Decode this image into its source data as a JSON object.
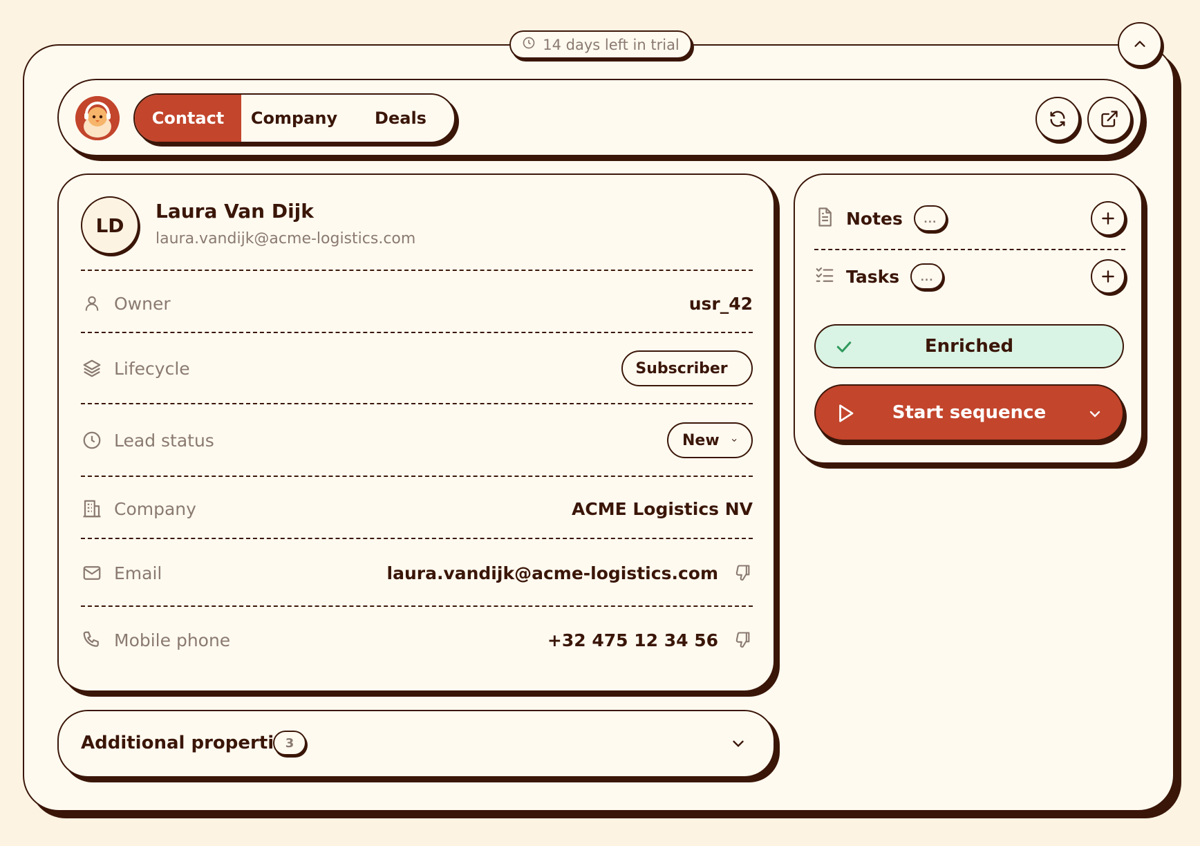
{
  "trial": {
    "text": "14 days left in trial"
  },
  "header": {
    "tabs": [
      {
        "label": "Contact",
        "active": true
      },
      {
        "label": "Company",
        "active": false
      },
      {
        "label": "Deals",
        "active": false
      }
    ]
  },
  "contact": {
    "initials": "LD",
    "name": "Laura Van Dijk",
    "email": "laura.vandijk@acme-logistics.com",
    "fields": {
      "owner": {
        "label": "Owner",
        "value": "usr_42"
      },
      "lifecycle": {
        "label": "Lifecycle",
        "value": "Subscriber"
      },
      "lead_status": {
        "label": "Lead status",
        "value": "New"
      },
      "company": {
        "label": "Company",
        "value": "ACME Logistics NV"
      },
      "email": {
        "label": "Email",
        "value": "laura.vandijk@acme-logistics.com"
      },
      "mobile": {
        "label": "Mobile phone",
        "value": "+32 475 12 34 56"
      }
    }
  },
  "additional": {
    "title": "Additional properties",
    "count": "3"
  },
  "side": {
    "notes": {
      "label": "Notes",
      "badge": "..."
    },
    "tasks": {
      "label": "Tasks",
      "badge": "..."
    },
    "enriched": "Enriched",
    "start_sequence": "Start sequence"
  },
  "colors": {
    "accent": "#c2452c",
    "ink": "#3a1608",
    "background": "#fdf3e3",
    "enriched_bg": "#d9f3e4",
    "check": "#2e9a5c"
  }
}
